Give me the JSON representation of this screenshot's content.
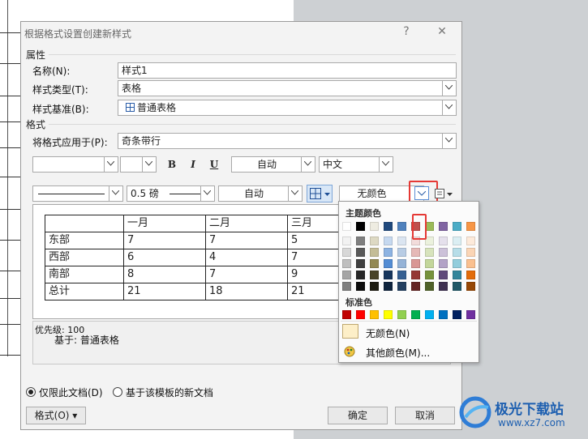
{
  "dialog": {
    "title": "根据格式设置创建新样式",
    "help": "?",
    "close": "✕",
    "section_properties": "属性",
    "section_format": "格式",
    "name_label": "名称(N):",
    "name_value": "样式1",
    "type_label": "样式类型(T):",
    "type_value": "表格",
    "base_label": "样式基准(B):",
    "base_value": "普通表格",
    "apply_label": "将格式应用于(P):",
    "apply_value": "奇条带行",
    "font_color": "自动",
    "lang": "中文",
    "bold": "B",
    "italic": "I",
    "underline": "U",
    "border_width": "0.5 磅",
    "border_color": "自动",
    "shading": "无颜色",
    "priority": "优先级: 100",
    "based_on": "基于: 普通表格",
    "radio_doc": "仅限此文档(D)",
    "radio_template": "基于该模板的新文档",
    "format_btn": "格式(O) ▾",
    "ok": "确定",
    "cancel": "取消"
  },
  "preview_table": {
    "header": [
      "",
      "一月",
      "二月",
      "三月"
    ],
    "rows": [
      [
        "东部",
        "7",
        "7",
        "5"
      ],
      [
        "西部",
        "6",
        "4",
        "7"
      ],
      [
        "南部",
        "8",
        "7",
        "9"
      ],
      [
        "总计",
        "21",
        "18",
        "21"
      ]
    ]
  },
  "color_popup": {
    "theme_title": "主题颜色",
    "standard_title": "标准色",
    "no_color": "无颜色(N)",
    "more_colors": "其他颜色(M)...",
    "theme_top": [
      "#ffffff",
      "#000000",
      "#eeece1",
      "#1f497d",
      "#4f81bd",
      "#c0504d",
      "#9bbb59",
      "#8064a2",
      "#4bacc6",
      "#f79646"
    ],
    "theme_shades": [
      [
        "#f2f2f2",
        "#7f7f7f",
        "#ddd9c3",
        "#c6d9f0",
        "#dbe5f1",
        "#f2dcdb",
        "#ebf1dd",
        "#e5e0ec",
        "#dbeef3",
        "#fdeada"
      ],
      [
        "#d8d8d8",
        "#595959",
        "#c4bd97",
        "#8db3e2",
        "#b8cce4",
        "#e5b9b7",
        "#d7e3bc",
        "#ccc1d9",
        "#b7dde8",
        "#fbd5b5"
      ],
      [
        "#bfbfbf",
        "#3f3f3f",
        "#938953",
        "#548dd4",
        "#95b3d7",
        "#d99694",
        "#c3d69b",
        "#b2a2c7",
        "#92cddc",
        "#fac08f"
      ],
      [
        "#a5a5a5",
        "#262626",
        "#494429",
        "#17365d",
        "#366092",
        "#953734",
        "#76923c",
        "#5f497a",
        "#31859b",
        "#e36c09"
      ],
      [
        "#7f7f7f",
        "#0c0c0c",
        "#1d1b10",
        "#0f243e",
        "#244061",
        "#632423",
        "#4f6128",
        "#3f3151",
        "#205867",
        "#974806"
      ]
    ],
    "standard": [
      "#c00000",
      "#ff0000",
      "#ffc000",
      "#ffff00",
      "#92d050",
      "#00b050",
      "#00b0f0",
      "#0070c0",
      "#002060",
      "#7030a0"
    ],
    "no_color_swatch": "#fdefc8"
  },
  "watermark": {
    "brand": "极光下载站",
    "url": "www.xz7.com"
  }
}
